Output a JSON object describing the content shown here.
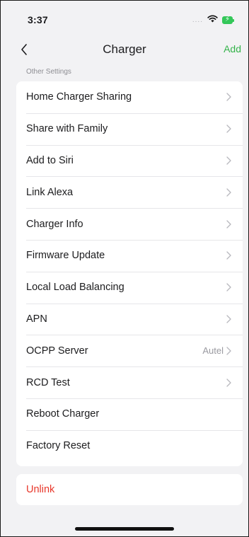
{
  "status_bar": {
    "time": "3:37",
    "signal_icon": "signal-dots-icon",
    "wifi_icon": "wifi-icon",
    "battery_icon": "battery-charging-icon",
    "signal_text": "...."
  },
  "nav": {
    "back_icon": "chevron-left-icon",
    "title": "Charger",
    "add_label": "Add"
  },
  "section": {
    "header": "Other Settings"
  },
  "settings": {
    "rows": [
      {
        "label": "Home Charger Sharing",
        "value": "",
        "chevron": true
      },
      {
        "label": "Share with Family",
        "value": "",
        "chevron": true
      },
      {
        "label": "Add to Siri",
        "value": "",
        "chevron": true
      },
      {
        "label": "Link Alexa",
        "value": "",
        "chevron": true
      },
      {
        "label": "Charger Info",
        "value": "",
        "chevron": true
      },
      {
        "label": "Firmware Update",
        "value": "",
        "chevron": true
      },
      {
        "label": "Local Load Balancing",
        "value": "",
        "chevron": true
      },
      {
        "label": "APN",
        "value": "",
        "chevron": true
      },
      {
        "label": "OCPP Server",
        "value": "Autel",
        "chevron": true
      },
      {
        "label": "RCD Test",
        "value": "",
        "chevron": true
      },
      {
        "label": "Reboot Charger",
        "value": "",
        "chevron": false
      },
      {
        "label": "Factory Reset",
        "value": "",
        "chevron": false
      }
    ]
  },
  "unlink": {
    "label": "Unlink"
  },
  "colors": {
    "accent_green": "#34b34a",
    "danger_red": "#e8372a",
    "background": "#f2f2f4",
    "card": "#ffffff"
  }
}
